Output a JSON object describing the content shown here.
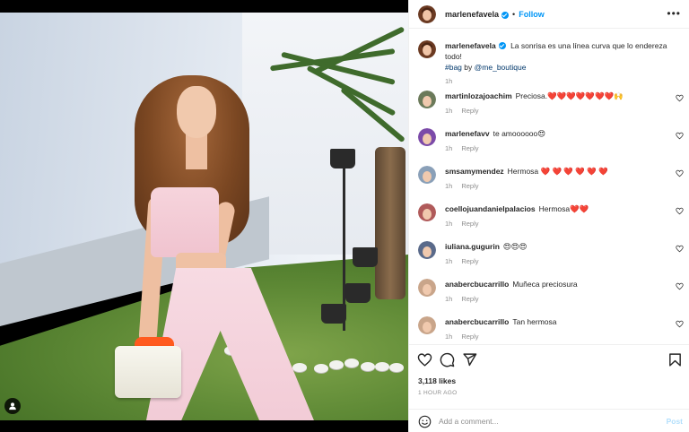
{
  "post": {
    "username": "marlenefavela",
    "follow_label": "Follow",
    "more_label": "•••",
    "dot": "•",
    "caption": {
      "text": "La sonrisa es una línea curva que lo endereza todo!",
      "hashtag": "#bag",
      "by_word": "by",
      "mention": "@me_boutique",
      "time": "1h"
    },
    "likes": "3,118 likes",
    "posted_ago": "1 HOUR AGO"
  },
  "comments": [
    {
      "user": "martinlozajoachim",
      "text": "Preciosa.❤️❤️❤️❤️❤️❤️❤️🙌",
      "time": "1h",
      "reply": "Reply",
      "avatar_color": "#6b7a5a"
    },
    {
      "user": "marlenefavv",
      "text": "te amoooooo😍",
      "time": "1h",
      "reply": "Reply",
      "avatar_color": "#7b4aa8"
    },
    {
      "user": "smsamymendez",
      "text": "Hermosa ❤️ ❤️ ❤️ ❤️ ❤️ ❤️",
      "time": "1h",
      "reply": "Reply",
      "avatar_color": "#8aa0b8"
    },
    {
      "user": "coellojuandanielpalacios",
      "text": "Hermosa❤️❤️",
      "time": "1h",
      "reply": "Reply",
      "avatar_color": "#b05a5a"
    },
    {
      "user": "iuliana.gugurin",
      "text": "😍😍😍",
      "time": "1h",
      "reply": "Reply",
      "avatar_color": "#5a6a8a"
    },
    {
      "user": "anabercbucarrillo",
      "text": "Muñeca preciosura",
      "time": "1h",
      "reply": "Reply",
      "avatar_color": "#c9a58a"
    },
    {
      "user": "anabercbucarrillo",
      "text": "Tan hermosa",
      "time": "1h",
      "reply": "Reply",
      "avatar_color": "#c9a58a"
    }
  ],
  "add_comment": {
    "placeholder": "Add a comment...",
    "post_label": "Post"
  },
  "icons": {
    "like": "heart-icon",
    "comment": "comment-icon",
    "share": "share-icon",
    "save": "bookmark-icon",
    "emoji": "emoji-icon",
    "tag": "user-tag-icon",
    "more": "more-icon"
  },
  "colors": {
    "accent": "#0095f6",
    "text": "#262626",
    "muted": "#8e8e8e",
    "heart_emoji": "#e0245e"
  }
}
